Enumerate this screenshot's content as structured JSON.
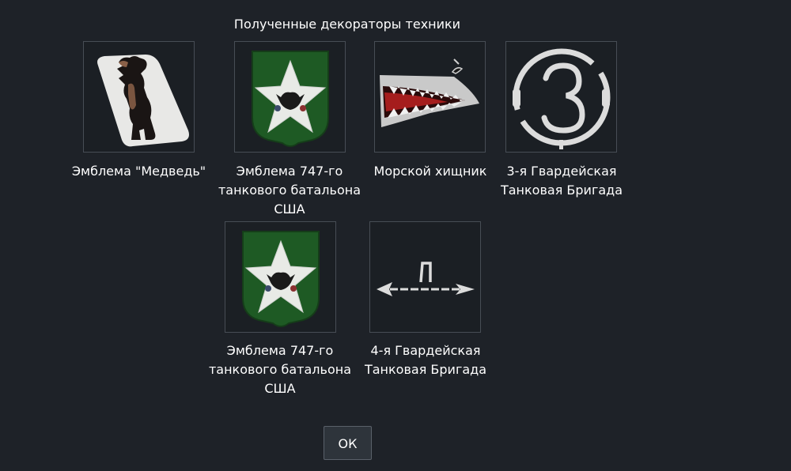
{
  "dialog": {
    "title": "Полученные декораторы техники",
    "ok_label": "ОК"
  },
  "decorators": [
    {
      "caption": "Эмблема \"Медведь\"",
      "icon": "bear-emblem-icon"
    },
    {
      "caption": "Эмблема 747-го\nтанкового батальона\nСША",
      "icon": "star-shield-emblem-icon"
    },
    {
      "caption": "Морской хищник",
      "icon": "shark-mouth-icon"
    },
    {
      "caption": "3-я Гвардейская\nТанковая Бригада",
      "icon": "number-three-emblem-icon"
    },
    {
      "caption": "Эмблема 747-го\nтанкового батальона\nСША",
      "icon": "star-shield-emblem-icon"
    },
    {
      "caption": "4-я Гвардейская\nТанковая Бригада",
      "icon": "arrow-emblem-icon"
    }
  ],
  "colors": {
    "background": "#1e2228",
    "tile_border": "#474d55",
    "shield_green": "#1e5a24"
  }
}
